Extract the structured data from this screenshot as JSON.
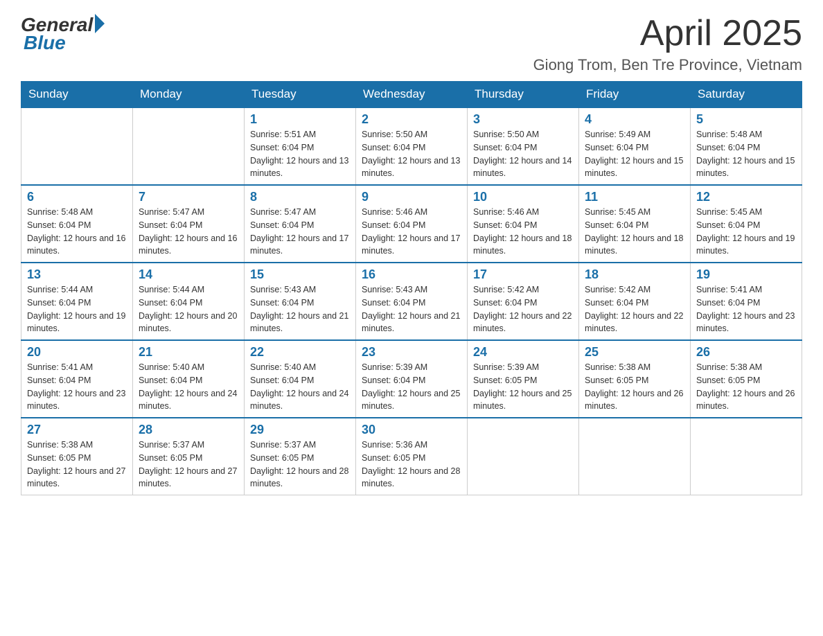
{
  "logo": {
    "general": "General",
    "blue": "Blue"
  },
  "header": {
    "month": "April 2025",
    "location": "Giong Trom, Ben Tre Province, Vietnam"
  },
  "weekdays": [
    "Sunday",
    "Monday",
    "Tuesday",
    "Wednesday",
    "Thursday",
    "Friday",
    "Saturday"
  ],
  "weeks": [
    [
      {
        "day": "",
        "sunrise": "",
        "sunset": "",
        "daylight": ""
      },
      {
        "day": "",
        "sunrise": "",
        "sunset": "",
        "daylight": ""
      },
      {
        "day": "1",
        "sunrise": "Sunrise: 5:51 AM",
        "sunset": "Sunset: 6:04 PM",
        "daylight": "Daylight: 12 hours and 13 minutes."
      },
      {
        "day": "2",
        "sunrise": "Sunrise: 5:50 AM",
        "sunset": "Sunset: 6:04 PM",
        "daylight": "Daylight: 12 hours and 13 minutes."
      },
      {
        "day": "3",
        "sunrise": "Sunrise: 5:50 AM",
        "sunset": "Sunset: 6:04 PM",
        "daylight": "Daylight: 12 hours and 14 minutes."
      },
      {
        "day": "4",
        "sunrise": "Sunrise: 5:49 AM",
        "sunset": "Sunset: 6:04 PM",
        "daylight": "Daylight: 12 hours and 15 minutes."
      },
      {
        "day": "5",
        "sunrise": "Sunrise: 5:48 AM",
        "sunset": "Sunset: 6:04 PM",
        "daylight": "Daylight: 12 hours and 15 minutes."
      }
    ],
    [
      {
        "day": "6",
        "sunrise": "Sunrise: 5:48 AM",
        "sunset": "Sunset: 6:04 PM",
        "daylight": "Daylight: 12 hours and 16 minutes."
      },
      {
        "day": "7",
        "sunrise": "Sunrise: 5:47 AM",
        "sunset": "Sunset: 6:04 PM",
        "daylight": "Daylight: 12 hours and 16 minutes."
      },
      {
        "day": "8",
        "sunrise": "Sunrise: 5:47 AM",
        "sunset": "Sunset: 6:04 PM",
        "daylight": "Daylight: 12 hours and 17 minutes."
      },
      {
        "day": "9",
        "sunrise": "Sunrise: 5:46 AM",
        "sunset": "Sunset: 6:04 PM",
        "daylight": "Daylight: 12 hours and 17 minutes."
      },
      {
        "day": "10",
        "sunrise": "Sunrise: 5:46 AM",
        "sunset": "Sunset: 6:04 PM",
        "daylight": "Daylight: 12 hours and 18 minutes."
      },
      {
        "day": "11",
        "sunrise": "Sunrise: 5:45 AM",
        "sunset": "Sunset: 6:04 PM",
        "daylight": "Daylight: 12 hours and 18 minutes."
      },
      {
        "day": "12",
        "sunrise": "Sunrise: 5:45 AM",
        "sunset": "Sunset: 6:04 PM",
        "daylight": "Daylight: 12 hours and 19 minutes."
      }
    ],
    [
      {
        "day": "13",
        "sunrise": "Sunrise: 5:44 AM",
        "sunset": "Sunset: 6:04 PM",
        "daylight": "Daylight: 12 hours and 19 minutes."
      },
      {
        "day": "14",
        "sunrise": "Sunrise: 5:44 AM",
        "sunset": "Sunset: 6:04 PM",
        "daylight": "Daylight: 12 hours and 20 minutes."
      },
      {
        "day": "15",
        "sunrise": "Sunrise: 5:43 AM",
        "sunset": "Sunset: 6:04 PM",
        "daylight": "Daylight: 12 hours and 21 minutes."
      },
      {
        "day": "16",
        "sunrise": "Sunrise: 5:43 AM",
        "sunset": "Sunset: 6:04 PM",
        "daylight": "Daylight: 12 hours and 21 minutes."
      },
      {
        "day": "17",
        "sunrise": "Sunrise: 5:42 AM",
        "sunset": "Sunset: 6:04 PM",
        "daylight": "Daylight: 12 hours and 22 minutes."
      },
      {
        "day": "18",
        "sunrise": "Sunrise: 5:42 AM",
        "sunset": "Sunset: 6:04 PM",
        "daylight": "Daylight: 12 hours and 22 minutes."
      },
      {
        "day": "19",
        "sunrise": "Sunrise: 5:41 AM",
        "sunset": "Sunset: 6:04 PM",
        "daylight": "Daylight: 12 hours and 23 minutes."
      }
    ],
    [
      {
        "day": "20",
        "sunrise": "Sunrise: 5:41 AM",
        "sunset": "Sunset: 6:04 PM",
        "daylight": "Daylight: 12 hours and 23 minutes."
      },
      {
        "day": "21",
        "sunrise": "Sunrise: 5:40 AM",
        "sunset": "Sunset: 6:04 PM",
        "daylight": "Daylight: 12 hours and 24 minutes."
      },
      {
        "day": "22",
        "sunrise": "Sunrise: 5:40 AM",
        "sunset": "Sunset: 6:04 PM",
        "daylight": "Daylight: 12 hours and 24 minutes."
      },
      {
        "day": "23",
        "sunrise": "Sunrise: 5:39 AM",
        "sunset": "Sunset: 6:04 PM",
        "daylight": "Daylight: 12 hours and 25 minutes."
      },
      {
        "day": "24",
        "sunrise": "Sunrise: 5:39 AM",
        "sunset": "Sunset: 6:05 PM",
        "daylight": "Daylight: 12 hours and 25 minutes."
      },
      {
        "day": "25",
        "sunrise": "Sunrise: 5:38 AM",
        "sunset": "Sunset: 6:05 PM",
        "daylight": "Daylight: 12 hours and 26 minutes."
      },
      {
        "day": "26",
        "sunrise": "Sunrise: 5:38 AM",
        "sunset": "Sunset: 6:05 PM",
        "daylight": "Daylight: 12 hours and 26 minutes."
      }
    ],
    [
      {
        "day": "27",
        "sunrise": "Sunrise: 5:38 AM",
        "sunset": "Sunset: 6:05 PM",
        "daylight": "Daylight: 12 hours and 27 minutes."
      },
      {
        "day": "28",
        "sunrise": "Sunrise: 5:37 AM",
        "sunset": "Sunset: 6:05 PM",
        "daylight": "Daylight: 12 hours and 27 minutes."
      },
      {
        "day": "29",
        "sunrise": "Sunrise: 5:37 AM",
        "sunset": "Sunset: 6:05 PM",
        "daylight": "Daylight: 12 hours and 28 minutes."
      },
      {
        "day": "30",
        "sunrise": "Sunrise: 5:36 AM",
        "sunset": "Sunset: 6:05 PM",
        "daylight": "Daylight: 12 hours and 28 minutes."
      },
      {
        "day": "",
        "sunrise": "",
        "sunset": "",
        "daylight": ""
      },
      {
        "day": "",
        "sunrise": "",
        "sunset": "",
        "daylight": ""
      },
      {
        "day": "",
        "sunrise": "",
        "sunset": "",
        "daylight": ""
      }
    ]
  ]
}
